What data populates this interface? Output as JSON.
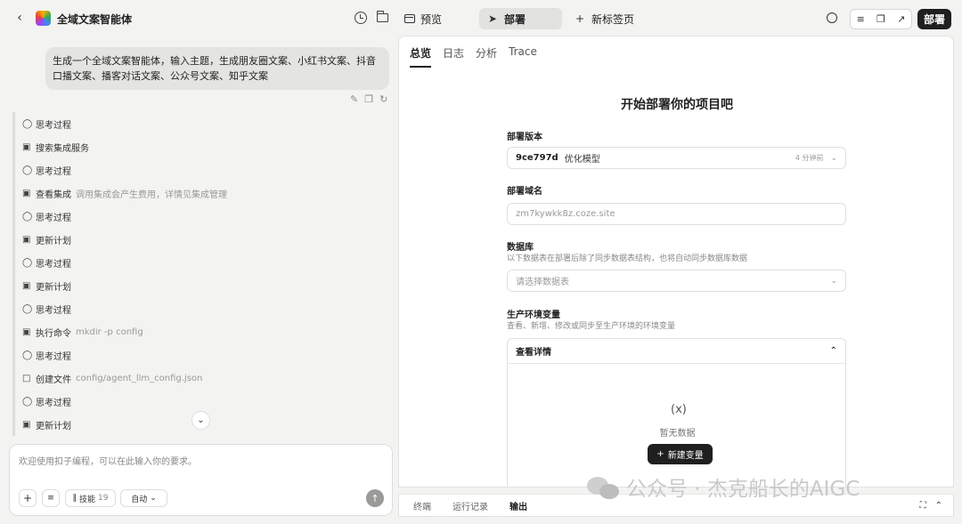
{
  "header": {
    "app_title": "全域文案智能体",
    "tabs": [
      {
        "label": "预览"
      },
      {
        "label": "部署"
      },
      {
        "label": "新标签页"
      }
    ],
    "deploy_button": "部署"
  },
  "chat": {
    "user_message": "生成一个全域文案智能体，输入主题，生成朋友圈文案、小红书文案、抖音口播文案、播客对话文案、公众号文案、知乎文案",
    "steps": [
      {
        "icon": "bulb-icon",
        "label": "思考过程",
        "detail": ""
      },
      {
        "icon": "terminal-icon",
        "label": "搜索集成服务",
        "detail": ""
      },
      {
        "icon": "bulb-icon",
        "label": "思考过程",
        "detail": ""
      },
      {
        "icon": "terminal-icon",
        "label": "查看集成",
        "detail": "调用集成会产生费用，详情见集成管理"
      },
      {
        "icon": "bulb-icon",
        "label": "思考过程",
        "detail": ""
      },
      {
        "icon": "terminal-icon",
        "label": "更新计划",
        "detail": ""
      },
      {
        "icon": "bulb-icon",
        "label": "思考过程",
        "detail": ""
      },
      {
        "icon": "terminal-icon",
        "label": "更新计划",
        "detail": ""
      },
      {
        "icon": "bulb-icon",
        "label": "思考过程",
        "detail": ""
      },
      {
        "icon": "terminal-icon",
        "label": "执行命令",
        "detail": "mkdir -p config"
      },
      {
        "icon": "bulb-icon",
        "label": "思考过程",
        "detail": ""
      },
      {
        "icon": "file-icon",
        "label": "创建文件",
        "detail": "config/agent_llm_config.json"
      },
      {
        "icon": "bulb-icon",
        "label": "思考过程",
        "detail": ""
      },
      {
        "icon": "terminal-icon",
        "label": "更新计划",
        "detail": ""
      }
    ],
    "input_placeholder": "欢迎使用扣子编程，可以在此输入你的要求。",
    "skill_label": "技能",
    "skill_count": "19",
    "mode_label": "自动"
  },
  "panel": {
    "tabs": [
      "总览",
      "日志",
      "分析",
      "Trace"
    ],
    "heading": "开始部署你的项目吧",
    "version_label": "部署版本",
    "version_id": "9ce797d",
    "version_name": "优化模型",
    "version_time": "4 分钟前",
    "domain_label": "部署域名",
    "domain_value": "zm7kywkk8z.coze.site",
    "db_label": "数据库",
    "db_desc": "以下数据表在部署后除了同步数据表结构，也将自动同步数据库数据",
    "db_placeholder": "请选择数据表",
    "env_label": "生产环境变量",
    "env_desc": "查看、新增、修改或同步至生产环境的环境变量",
    "env_view": "查看详情",
    "empty_text": "暂无数据",
    "new_var": "新建变量"
  },
  "bottom": {
    "tabs": [
      "终端",
      "运行记录",
      "输出"
    ]
  },
  "watermark": "公众号 · 杰克船长的AIGC"
}
